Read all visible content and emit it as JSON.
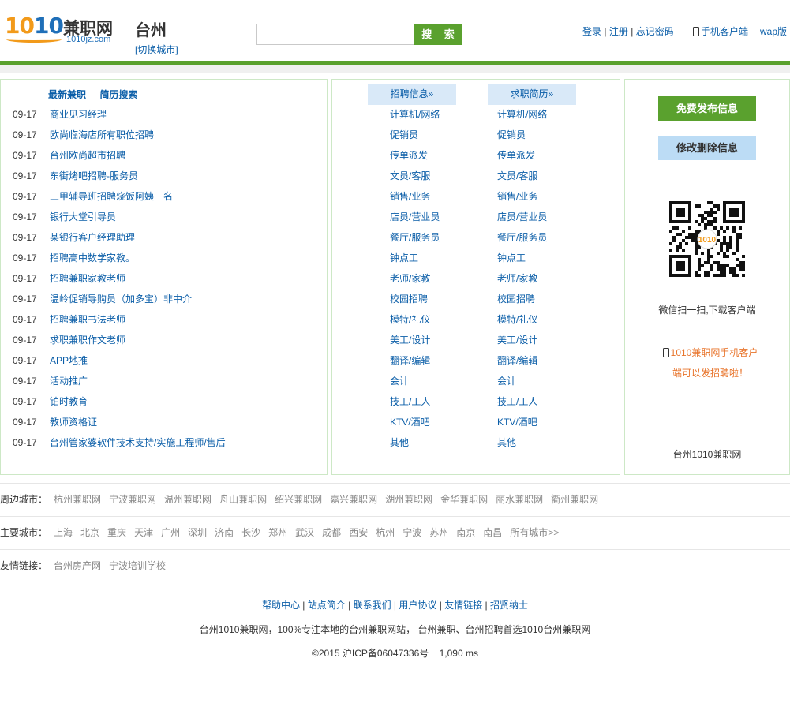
{
  "header": {
    "logo": {
      "num_a": "10",
      "num_b": "10",
      "cn": "兼职网",
      "domain": "1010jz.com"
    },
    "city": "台州",
    "switch_city": "[切换城市]",
    "search_input_value": "",
    "search_button": "搜 索",
    "login": "登录",
    "register": "注册",
    "forgot_password": "忘记密码",
    "separator": "|",
    "mobile_client": "手机客户端",
    "wap": "wap版"
  },
  "left_panel": {
    "tabs": [
      "最新兼职",
      "简历搜索"
    ],
    "items": [
      {
        "date": "09-17",
        "title": "商业见习经理"
      },
      {
        "date": "09-17",
        "title": "欧尚临海店所有职位招聘"
      },
      {
        "date": "09-17",
        "title": "台州欧尚超市招聘"
      },
      {
        "date": "09-17",
        "title": "东街烤吧招聘-服务员"
      },
      {
        "date": "09-17",
        "title": "三甲辅导班招聘烧饭阿姨一名"
      },
      {
        "date": "09-17",
        "title": "银行大堂引导员"
      },
      {
        "date": "09-17",
        "title": "某银行客户经理助理"
      },
      {
        "date": "09-17",
        "title": "招聘高中数学家教。"
      },
      {
        "date": "09-17",
        "title": "招聘兼职家教老师"
      },
      {
        "date": "09-17",
        "title": "温岭促销导购员（加多宝）非中介"
      },
      {
        "date": "09-17",
        "title": "招聘兼职书法老师"
      },
      {
        "date": "09-17",
        "title": "求职兼职作文老师"
      },
      {
        "date": "09-17",
        "title": "APP地推"
      },
      {
        "date": "09-17",
        "title": "活动推广"
      },
      {
        "date": "09-17",
        "title": "铂时教育"
      },
      {
        "date": "09-17",
        "title": "教师资格证"
      },
      {
        "date": "09-17",
        "title": "台州管家婆软件技术支持/实施工程师/售后"
      }
    ]
  },
  "middle_panel": {
    "recruit_header": "招聘信息»",
    "resume_header": "求职简历»",
    "recruit_categories": [
      "计算机/网络",
      "促销员",
      "传单派发",
      "文员/客服",
      "销售/业务",
      "店员/营业员",
      "餐厅/服务员",
      "钟点工",
      "老师/家教",
      "校园招聘",
      "模特/礼仪",
      "美工/设计",
      "翻译/编辑",
      "会计",
      "技工/工人",
      "KTV/酒吧",
      "其他"
    ],
    "resume_categories": [
      "计算机/网络",
      "促销员",
      "传单派发",
      "文员/客服",
      "销售/业务",
      "店员/营业员",
      "餐厅/服务员",
      "钟点工",
      "老师/家教",
      "校园招聘",
      "模特/礼仪",
      "美工/设计",
      "翻译/编辑",
      "会计",
      "技工/工人",
      "KTV/酒吧",
      "其他"
    ]
  },
  "right_panel": {
    "publish_button": "免费发布信息",
    "edit_button": "修改删除信息",
    "qr_logo_text": "1010",
    "qr_caption": "微信扫一扫,下载客户端",
    "promo_line1": "1010兼职网手机客户",
    "promo_line2": "端可以发招聘啦！",
    "site_name": "台州1010兼职网"
  },
  "nearby": {
    "label": "周边城市：",
    "items": [
      "杭州兼职网",
      "宁波兼职网",
      "温州兼职网",
      "舟山兼职网",
      "绍兴兼职网",
      "嘉兴兼职网",
      "湖州兼职网",
      "金华兼职网",
      "丽水兼职网",
      "衢州兼职网"
    ]
  },
  "major": {
    "label": "主要城市：",
    "items": [
      "上海",
      "北京",
      "重庆",
      "天津",
      "广州",
      "深圳",
      "济南",
      "长沙",
      "郑州",
      "武汉",
      "成都",
      "西安",
      "杭州",
      "宁波",
      "苏州",
      "南京",
      "南昌",
      "所有城市>>"
    ]
  },
  "friends": {
    "label": "友情链接：",
    "items": [
      "台州房产网",
      "宁波培训学校"
    ]
  },
  "footer": {
    "links": [
      "帮助中心",
      "站点简介",
      "联系我们",
      "用户协议",
      "友情链接",
      "招贤纳士"
    ],
    "separator": " | ",
    "description": "台州1010兼职网，100%专注本地的台州兼职网站， 台州兼职、台州招聘首选1010台州兼职网",
    "copyright": "©2015 沪ICP备06047336号",
    "timing": "1,090 ms"
  },
  "colors": {
    "green": "#5aa12e",
    "link_blue": "#0b5ea8",
    "header_blue_bg": "#d9e9f8",
    "orange": "#e8742b"
  }
}
